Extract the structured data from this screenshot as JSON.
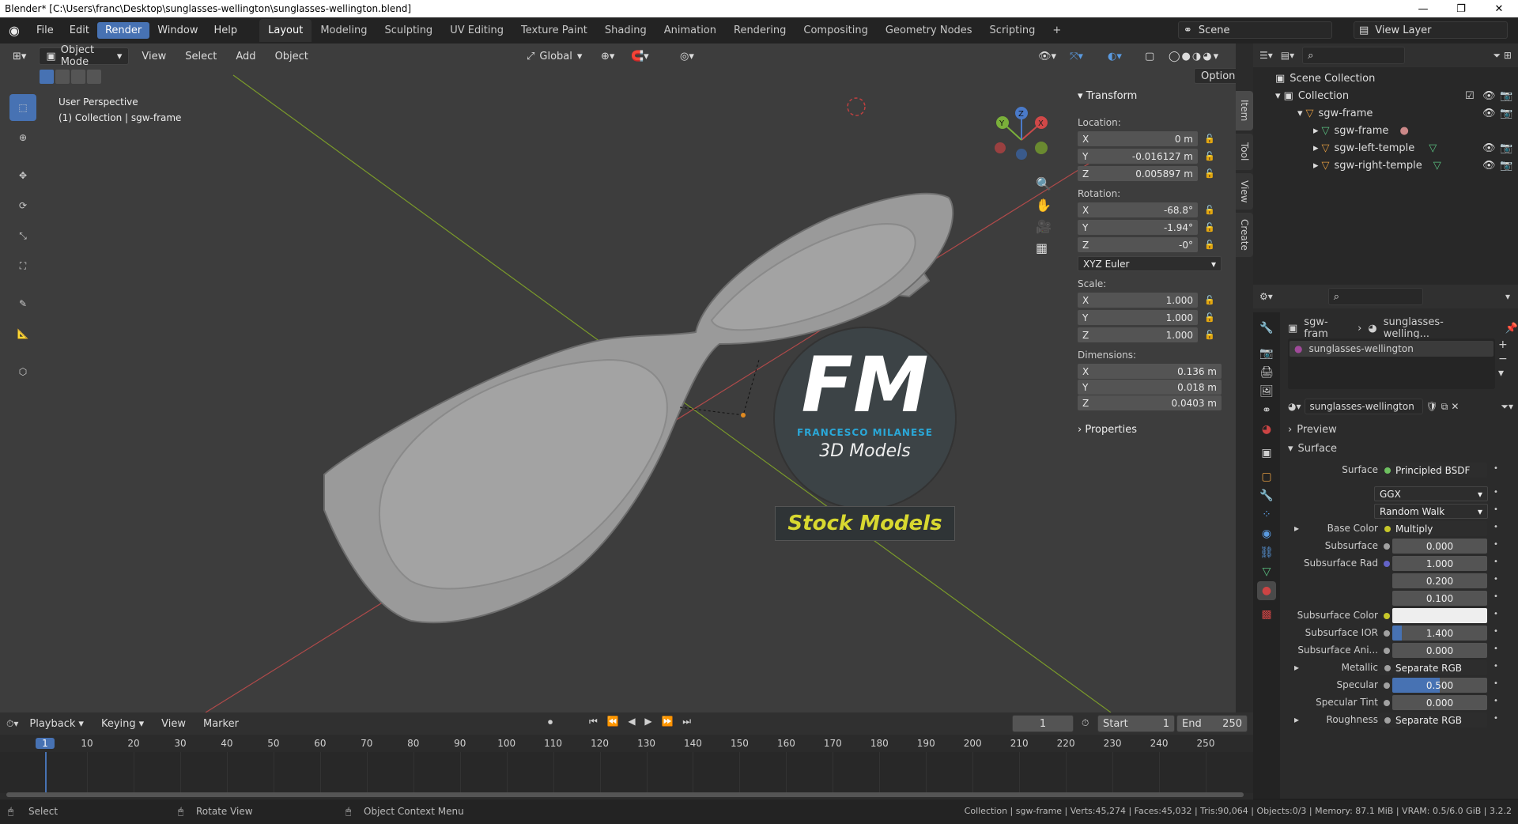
{
  "title": "Blender* [C:\\Users\\franc\\Desktop\\sunglasses-wellington\\sunglasses-wellington.blend]",
  "menu": [
    "File",
    "Edit",
    "Render",
    "Window",
    "Help"
  ],
  "workspaces": [
    "Layout",
    "Modeling",
    "Sculpting",
    "UV Editing",
    "Texture Paint",
    "Shading",
    "Animation",
    "Rendering",
    "Compositing",
    "Geometry Nodes",
    "Scripting"
  ],
  "scene_label": "Scene",
  "view_layer_label": "View Layer",
  "viewport": {
    "mode": "Object Mode",
    "menus": [
      "View",
      "Select",
      "Add",
      "Object"
    ],
    "transform_orientation": "Global",
    "options": "Options",
    "perspective": "User Perspective",
    "collection_info": "(1) Collection | sgw-frame"
  },
  "watermark": {
    "letters": "FM",
    "name": "FRANCESCO MILANESE",
    "sub": "3D Models",
    "banner": "Stock Models"
  },
  "npanel": {
    "transform": "Transform",
    "location_label": "Location:",
    "location": [
      "0 m",
      "-0.016127 m",
      "0.005897 m"
    ],
    "rotation_label": "Rotation:",
    "rotation": [
      "-68.8°",
      "-1.94°",
      "-0°"
    ],
    "rotation_mode": "XYZ Euler",
    "scale_label": "Scale:",
    "scale": [
      "1.000",
      "1.000",
      "1.000"
    ],
    "dimensions_label": "Dimensions:",
    "dimensions": [
      "0.136 m",
      "0.018 m",
      "0.0403 m"
    ],
    "properties": "Properties",
    "axes": [
      "X",
      "Y",
      "Z"
    ],
    "tabs": [
      "Item",
      "Tool",
      "View",
      "Create"
    ]
  },
  "outliner": {
    "rows": [
      "Scene Collection",
      "Collection",
      "sgw-frame",
      "sgw-frame",
      "sgw-left-temple",
      "sgw-right-temple"
    ]
  },
  "properties": {
    "breadcrumb_obj": "sgw-fram",
    "breadcrumb_mat": "sunglasses-welling...",
    "slot": "sunglasses-wellington",
    "material": "sunglasses-wellington",
    "preview": "Preview",
    "surface_panel": "Surface",
    "rows": [
      {
        "label": "Surface",
        "value": "Principled BSDF",
        "kind": "link",
        "dot": "#6ec060"
      },
      {
        "label": "",
        "value": "GGX",
        "kind": "dd"
      },
      {
        "label": "",
        "value": "Random Walk",
        "kind": "dd"
      },
      {
        "label": "Base Color",
        "value": "Multiply",
        "kind": "link",
        "dot": "#c7c729"
      },
      {
        "label": "Subsurface",
        "value": "0.000",
        "kind": "num",
        "dot": "#a1a1a1"
      },
      {
        "label": "Subsurface Rad",
        "value": "1.000",
        "kind": "num",
        "dot": "#6363c7"
      },
      {
        "label": "",
        "value": "0.200",
        "kind": "num"
      },
      {
        "label": "",
        "value": "0.100",
        "kind": "num"
      },
      {
        "label": "Subsurface Color",
        "value": "",
        "kind": "color",
        "dot": "#c7c729"
      },
      {
        "label": "Subsurface IOR",
        "value": "1.400",
        "kind": "num",
        "dot": "#a1a1a1"
      },
      {
        "label": "Subsurface Ani...",
        "value": "0.000",
        "kind": "num",
        "dot": "#a1a1a1"
      },
      {
        "label": "Metallic",
        "value": "Separate RGB",
        "kind": "link",
        "dot": "#a1a1a1"
      },
      {
        "label": "Specular",
        "value": "0.500",
        "kind": "bar",
        "dot": "#a1a1a1"
      },
      {
        "label": "Specular Tint",
        "value": "0.000",
        "kind": "num",
        "dot": "#a1a1a1"
      },
      {
        "label": "Roughness",
        "value": "Separate RGB",
        "kind": "link",
        "dot": "#a1a1a1"
      }
    ]
  },
  "timeline": {
    "menus": [
      "Playback",
      "Keying",
      "View",
      "Marker"
    ],
    "current_frame": "1",
    "start_label": "Start",
    "start": "1",
    "end_label": "End",
    "end": "250",
    "ticks": [
      "1",
      "10",
      "20",
      "30",
      "40",
      "50",
      "60",
      "70",
      "80",
      "90",
      "100",
      "110",
      "120",
      "130",
      "140",
      "150",
      "160",
      "170",
      "180",
      "190",
      "200",
      "210",
      "220",
      "230",
      "240",
      "250"
    ]
  },
  "status": {
    "select": "Select",
    "rotate": "Rotate View",
    "context": "Object Context Menu",
    "stats": "Collection | sgw-frame | Verts:45,274 | Faces:45,032 | Tris:90,064 | Objects:0/3 | Memory: 87.1 MiB | VRAM: 0.5/6.0 GiB | 3.2.2"
  }
}
